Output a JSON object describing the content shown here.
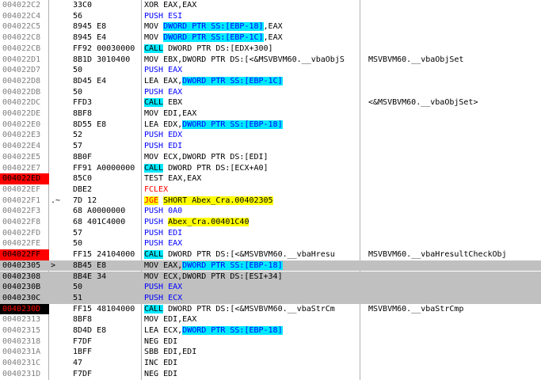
{
  "colors": {
    "breakpoint": "#ff0000",
    "selection": "#c0c0c0",
    "call_highlight": "#00e8ff",
    "jump_highlight": "#ffff00",
    "push_text": "#0000ff"
  },
  "rows": [
    {
      "addr": "004022C2",
      "mark": "",
      "hex": "33C0",
      "dis": [
        [
          "XOR EAX,EAX",
          ""
        ]
      ],
      "comment": ""
    },
    {
      "addr": "004022C4",
      "mark": "",
      "hex": "56",
      "dis": [
        [
          "PUSH ESI",
          "push"
        ]
      ],
      "comment": ""
    },
    {
      "addr": "004022C5",
      "mark": "",
      "hex": "8945 E8",
      "dis": [
        [
          "MOV ",
          ""
        ],
        [
          "DWORD PTR SS:[EBP-18]",
          "memref"
        ],
        [
          ",EAX",
          ""
        ]
      ],
      "comment": ""
    },
    {
      "addr": "004022C8",
      "mark": "",
      "hex": "8945 E4",
      "dis": [
        [
          "MOV ",
          ""
        ],
        [
          "DWORD PTR SS:[EBP-1C]",
          "memref"
        ],
        [
          ",EAX",
          ""
        ]
      ],
      "comment": ""
    },
    {
      "addr": "004022CB",
      "mark": "",
      "hex": "FF92 00030000",
      "dis": [
        [
          "CALL",
          "call"
        ],
        [
          " DWORD PTR DS:[EDX+300]",
          ""
        ]
      ],
      "comment": ""
    },
    {
      "addr": "004022D1",
      "mark": "",
      "hex": "8B1D 3010400",
      "dis": [
        [
          "MOV EBX,DWORD PTR DS:[<&MSVBVM60.__vbaObjS",
          ""
        ]
      ],
      "comment": "MSVBVM60.__vbaObjSet"
    },
    {
      "addr": "004022D7",
      "mark": "",
      "hex": "50",
      "dis": [
        [
          "PUSH EAX",
          "push"
        ]
      ],
      "comment": ""
    },
    {
      "addr": "004022D8",
      "mark": "",
      "hex": "8D45 E4",
      "dis": [
        [
          "LEA EAX,",
          ""
        ],
        [
          "DWORD PTR SS:[EBP-1C]",
          "memref"
        ]
      ],
      "comment": ""
    },
    {
      "addr": "004022DB",
      "mark": "",
      "hex": "50",
      "dis": [
        [
          "PUSH EAX",
          "push"
        ]
      ],
      "comment": ""
    },
    {
      "addr": "004022DC",
      "mark": "",
      "hex": "FFD3",
      "dis": [
        [
          "CALL",
          "call"
        ],
        [
          " EBX",
          ""
        ]
      ],
      "comment": "<&MSVBVM60.__vbaObjSet>"
    },
    {
      "addr": "004022DE",
      "mark": "",
      "hex": "8BF8",
      "dis": [
        [
          "MOV EDI,EAX",
          ""
        ]
      ],
      "comment": ""
    },
    {
      "addr": "004022E0",
      "mark": "",
      "hex": "8D55 E8",
      "dis": [
        [
          "LEA EDX,",
          ""
        ],
        [
          "DWORD PTR SS:[EBP-18]",
          "memref"
        ]
      ],
      "comment": ""
    },
    {
      "addr": "004022E3",
      "mark": "",
      "hex": "52",
      "dis": [
        [
          "PUSH EDX",
          "push"
        ]
      ],
      "comment": ""
    },
    {
      "addr": "004022E4",
      "mark": "",
      "hex": "57",
      "dis": [
        [
          "PUSH EDI",
          "push"
        ]
      ],
      "comment": ""
    },
    {
      "addr": "004022E5",
      "mark": "",
      "hex": "8B0F",
      "dis": [
        [
          "MOV ECX,DWORD PTR DS:[EDI]",
          ""
        ]
      ],
      "comment": ""
    },
    {
      "addr": "004022E7",
      "mark": "",
      "hex": "FF91 A0000000",
      "dis": [
        [
          "CALL",
          "call"
        ],
        [
          " DWORD PTR DS:[ECX+A0]",
          ""
        ]
      ],
      "comment": ""
    },
    {
      "addr": "004022ED",
      "mark": "",
      "hex": "85C0",
      "dis": [
        [
          "TEST EAX,EAX",
          ""
        ]
      ],
      "comment": "",
      "bp": "bp"
    },
    {
      "addr": "004022EF",
      "mark": "",
      "hex": "DBE2",
      "dis": [
        [
          "FCLEX",
          "red"
        ]
      ],
      "comment": ""
    },
    {
      "addr": "004022F1",
      "mark": ".~",
      "hex": "7D 12",
      "dis": [
        [
          "JGE",
          "jcc"
        ],
        [
          " ",
          ""
        ],
        [
          "SHORT Abex_Cra.00402305",
          "jtarget"
        ]
      ],
      "comment": ""
    },
    {
      "addr": "004022F3",
      "mark": "",
      "hex": "68 A0000000",
      "dis": [
        [
          "PUSH 0A0",
          "push"
        ]
      ],
      "comment": ""
    },
    {
      "addr": "004022F8",
      "mark": "",
      "hex": "68 401C4000",
      "dis": [
        [
          "PUSH ",
          "push"
        ],
        [
          "Abex_Cra.00401C40",
          "jtarget"
        ]
      ],
      "comment": ""
    },
    {
      "addr": "004022FD",
      "mark": "",
      "hex": "57",
      "dis": [
        [
          "PUSH EDI",
          "push"
        ]
      ],
      "comment": ""
    },
    {
      "addr": "004022FE",
      "mark": "",
      "hex": "50",
      "dis": [
        [
          "PUSH EAX",
          "push"
        ]
      ],
      "comment": ""
    },
    {
      "addr": "004022FF",
      "mark": "",
      "hex": "FF15 24104000",
      "dis": [
        [
          "CALL",
          "call"
        ],
        [
          " DWORD PTR DS:[<&MSVBVM60.__vbaHresu",
          ""
        ]
      ],
      "comment": "MSVBVM60.__vbaHresultCheckObj",
      "bp": "bp"
    },
    {
      "addr": "00402305",
      "mark": ">",
      "hex": "8B45 E8",
      "dis": [
        [
          "MOV EAX,",
          ""
        ],
        [
          "DWORD PTR SS:[EBP-18]",
          "memref"
        ]
      ],
      "comment": "",
      "sel": true
    },
    {
      "addr": "00402308",
      "mark": "",
      "hex": "8B4E 34",
      "dis": [
        [
          "MOV ECX,DWORD PTR DS:[ESI+34]",
          ""
        ]
      ],
      "comment": "",
      "sel": true
    },
    {
      "addr": "0040230B",
      "mark": "",
      "hex": "50",
      "dis": [
        [
          "PUSH EAX",
          "push"
        ]
      ],
      "comment": "",
      "sel": true
    },
    {
      "addr": "0040230C",
      "mark": "",
      "hex": "51",
      "dis": [
        [
          "PUSH ECX",
          "push"
        ]
      ],
      "comment": "",
      "sel": true
    },
    {
      "addr": "0040230D",
      "mark": "",
      "hex": "FF15 48104000",
      "dis": [
        [
          "CALL",
          "call"
        ],
        [
          " DWORD PTR DS:[<&MSVBVM60.__vbaStrCm",
          ""
        ]
      ],
      "comment": "MSVBVM60.__vbaStrCmp",
      "bp": "bpsel"
    },
    {
      "addr": "00402313",
      "mark": "",
      "hex": "8BF8",
      "dis": [
        [
          "MOV EDI,EAX",
          ""
        ]
      ],
      "comment": ""
    },
    {
      "addr": "00402315",
      "mark": "",
      "hex": "8D4D E8",
      "dis": [
        [
          "LEA ECX,",
          ""
        ],
        [
          "DWORD PTR SS:[EBP-18]",
          "memref"
        ]
      ],
      "comment": ""
    },
    {
      "addr": "00402318",
      "mark": "",
      "hex": "F7DF",
      "dis": [
        [
          "NEG EDI",
          ""
        ]
      ],
      "comment": ""
    },
    {
      "addr": "0040231A",
      "mark": "",
      "hex": "1BFF",
      "dis": [
        [
          "SBB EDI,EDI",
          ""
        ]
      ],
      "comment": ""
    },
    {
      "addr": "0040231C",
      "mark": "",
      "hex": "47",
      "dis": [
        [
          "INC EDI",
          ""
        ]
      ],
      "comment": ""
    },
    {
      "addr": "0040231D",
      "mark": "",
      "hex": "F7DF",
      "dis": [
        [
          "NEG EDI",
          ""
        ]
      ],
      "comment": ""
    }
  ]
}
